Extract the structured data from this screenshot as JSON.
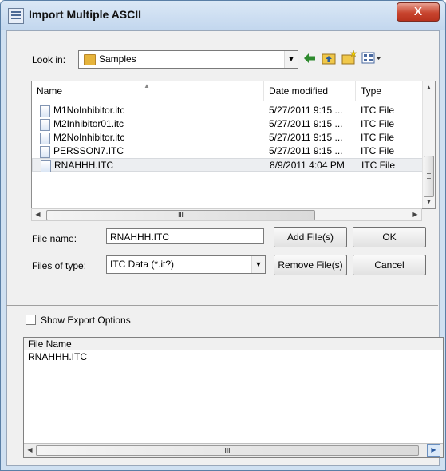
{
  "window": {
    "title": "Import Multiple ASCII",
    "close_glyph": "X"
  },
  "look_in": {
    "label": "Look in:",
    "value": "Samples"
  },
  "toolbar_icons": [
    "back-icon",
    "up-folder-icon",
    "new-folder-icon",
    "view-menu-icon"
  ],
  "file_list": {
    "columns": [
      "Name",
      "Date modified",
      "Type"
    ],
    "rows": [
      {
        "name": "M1NoInhibitor.itc",
        "date": "5/27/2011 9:15 ...",
        "type": "ITC File"
      },
      {
        "name": "M2Inhibitor01.itc",
        "date": "5/27/2011 9:15 ...",
        "type": "ITC File"
      },
      {
        "name": "M2NoInhibitor.itc",
        "date": "5/27/2011 9:15 ...",
        "type": "ITC File"
      },
      {
        "name": "PERSSON7.ITC",
        "date": "5/27/2011 9:15 ...",
        "type": "ITC File"
      },
      {
        "name": "RNAHHH.ITC",
        "date": "8/9/2011 4:04 PM",
        "type": "ITC File"
      }
    ],
    "selected_index": 4,
    "hscroll_grip": "III"
  },
  "file_name": {
    "label": "File name:",
    "value": "RNAHHH.ITC"
  },
  "files_of_type": {
    "label": "Files of type:",
    "value": "ITC Data (*.it?)"
  },
  "buttons": {
    "add_files": "Add File(s)",
    "ok": "OK",
    "remove_files": "Remove File(s)",
    "cancel": "Cancel"
  },
  "show_export_options": {
    "label": "Show Export Options",
    "checked": false
  },
  "import_list": {
    "header": "File Name",
    "items": [
      "RNAHHH.ITC"
    ],
    "hscroll_grip": "III"
  }
}
